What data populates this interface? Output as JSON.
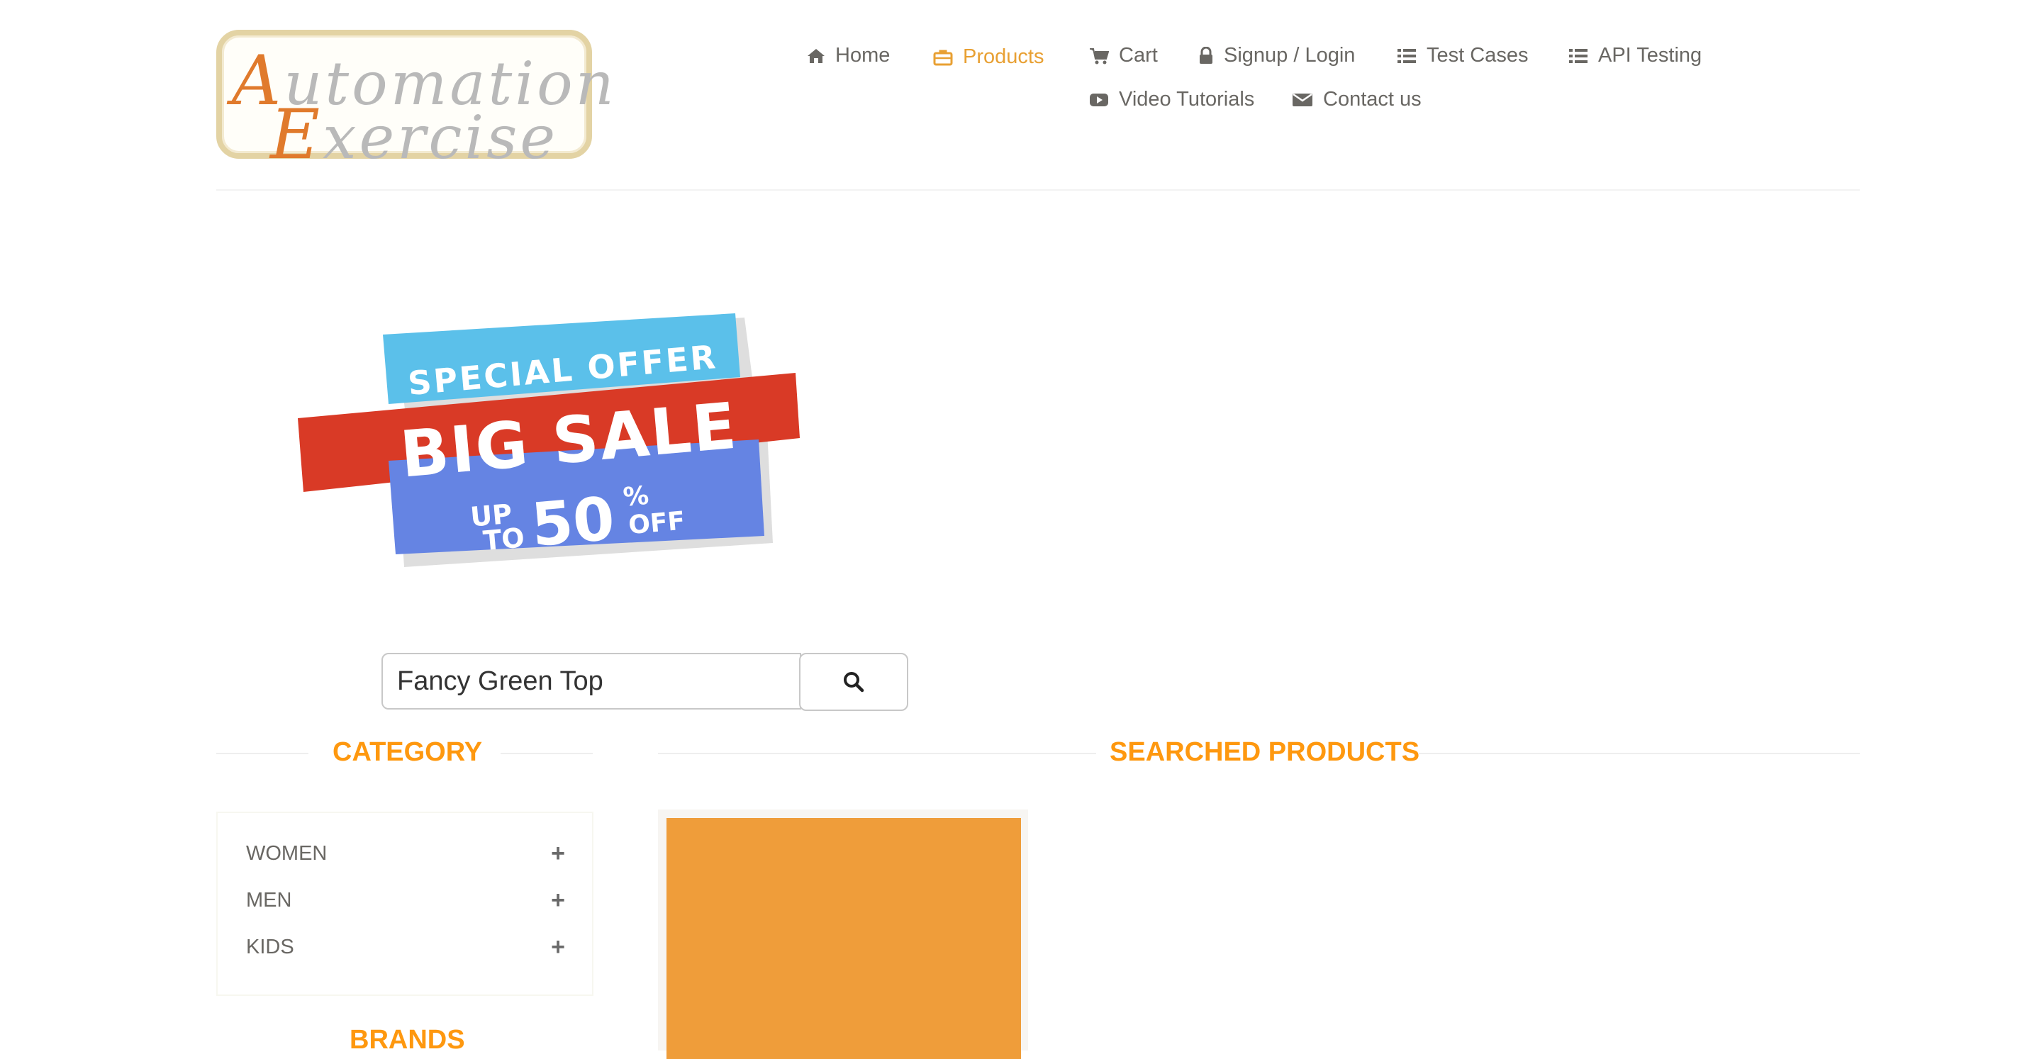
{
  "logo": {
    "line1_first": "A",
    "line1_rest": "utomation",
    "line2_first": "E",
    "line2_rest": "xercise"
  },
  "nav": {
    "home": "Home",
    "products": "Products",
    "cart": "Cart",
    "signup_login": "Signup / Login",
    "test_cases": "Test Cases",
    "api_testing": "API Testing",
    "video_tutorials": "Video Tutorials",
    "contact_us": "Contact us"
  },
  "banner": {
    "line1": "SPECIAL OFFER",
    "line2": "BIG SALE",
    "up": "UP",
    "to": "TO",
    "percent_value": "50",
    "percent_sign": "%",
    "off": "OFF"
  },
  "search": {
    "value": "Fancy Green Top"
  },
  "sidebar": {
    "category_title": "CATEGORY",
    "categories": [
      "WOMEN",
      "MEN",
      "KIDS"
    ],
    "brands_title": "BRANDS"
  },
  "main": {
    "title": "SEARCHED PRODUCTS"
  },
  "colors": {
    "accent": "#fe980f",
    "active_nav": "#e8a033",
    "text": "#696763",
    "product_image": "#ef9d3a"
  },
  "icons": [
    "home-icon",
    "briefcase-icon",
    "cart-icon",
    "lock-icon",
    "list-icon",
    "youtube-icon",
    "envelope-icon",
    "search-icon",
    "plus-icon"
  ]
}
